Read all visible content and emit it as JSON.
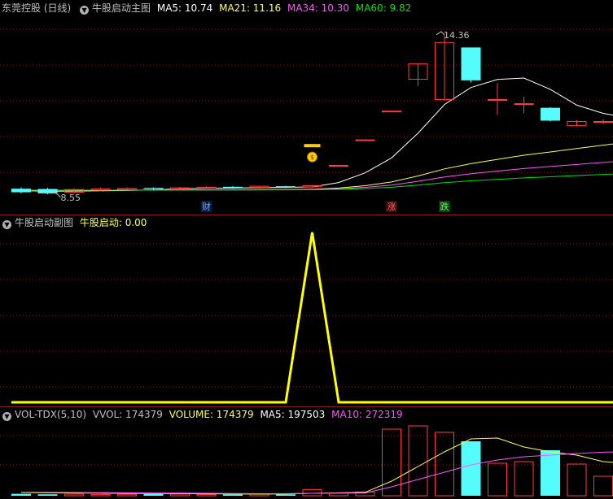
{
  "main": {
    "title": "东莞控股 (日线)",
    "indicator": "牛股启动主图",
    "ma5": "MA5: 10.74",
    "ma21": "MA21: 11.16",
    "ma34": "MA34: 10.30",
    "ma60": "MA60: 9.82",
    "high_label": "14.36",
    "low_label": "8.55",
    "markers": {
      "cai": "财",
      "zhang": "涨",
      "die": "跌"
    },
    "dollar_icon": "money-bag-icon"
  },
  "sub": {
    "title": "牛股启动副图",
    "value_label": "牛股启动: 0.00"
  },
  "vol": {
    "title": "VOL-TDX(5,10)",
    "vvol": "VVOL: 174379",
    "volume": "VOLUME: 174379",
    "ma5": "MA5: 197503",
    "ma10": "MA10: 272319"
  },
  "colors": {
    "up": "#ff3c3c",
    "down": "#54fcfc",
    "ma5": "#ffffff",
    "ma21": "#ffff55",
    "ma34": "#ff55ff",
    "ma60": "#00e000",
    "signal": "#ffff00",
    "grid": "#8b1a1a"
  },
  "chart_data": {
    "type": "candlestick",
    "candles": [
      {
        "o": 8.75,
        "c": 8.62,
        "h": 8.8,
        "l": 8.58
      },
      {
        "o": 8.74,
        "c": 8.58,
        "h": 8.78,
        "l": 8.55
      },
      {
        "o": 8.62,
        "c": 8.72,
        "h": 8.76,
        "l": 8.58
      },
      {
        "o": 8.7,
        "c": 8.74,
        "h": 8.78,
        "l": 8.66
      },
      {
        "o": 8.72,
        "c": 8.76,
        "h": 8.8,
        "l": 8.7
      },
      {
        "o": 8.78,
        "c": 8.74,
        "h": 8.8,
        "l": 8.7
      },
      {
        "o": 8.74,
        "c": 8.78,
        "h": 8.82,
        "l": 8.72
      },
      {
        "o": 8.78,
        "c": 8.8,
        "h": 8.84,
        "l": 8.74
      },
      {
        "o": 8.82,
        "c": 8.78,
        "h": 8.85,
        "l": 8.74
      },
      {
        "o": 8.8,
        "c": 8.84,
        "h": 8.86,
        "l": 8.76
      },
      {
        "o": 8.84,
        "c": 8.8,
        "h": 8.86,
        "l": 8.77
      },
      {
        "o": 8.82,
        "c": 8.86,
        "h": 8.88,
        "l": 8.78
      },
      {
        "o": 9.6,
        "c": 9.6,
        "h": 9.6,
        "l": 9.6
      },
      {
        "o": 10.53,
        "c": 10.53,
        "h": 10.53,
        "l": 10.53
      },
      {
        "o": 11.58,
        "c": 11.58,
        "h": 11.58,
        "l": 11.58
      },
      {
        "o": 12.74,
        "c": 13.3,
        "h": 13.3,
        "l": 12.5
      },
      {
        "o": 12.0,
        "c": 14.08,
        "h": 14.36,
        "l": 12.0
      },
      {
        "o": 13.9,
        "c": 12.7,
        "h": 13.9,
        "l": 12.62
      },
      {
        "o": 12.0,
        "c": 12.0,
        "h": 12.6,
        "l": 11.45
      },
      {
        "o": 11.85,
        "c": 11.85,
        "h": 12.1,
        "l": 11.5
      },
      {
        "o": 11.7,
        "c": 11.23,
        "h": 11.72,
        "l": 11.2
      },
      {
        "o": 11.05,
        "c": 11.2,
        "h": 11.25,
        "l": 11.05
      },
      {
        "o": 11.2,
        "c": 11.2,
        "h": 11.28,
        "l": 11.1
      },
      {
        "o": 11.2,
        "c": 11.12,
        "h": 11.22,
        "l": 11.1
      }
    ],
    "signal": [
      0,
      0,
      0,
      0,
      0,
      0,
      0,
      0,
      0,
      0,
      0,
      1,
      0,
      0,
      0,
      0,
      0,
      0,
      0,
      0,
      0,
      0,
      0,
      0
    ],
    "volume": {
      "values": [
        12000,
        9000,
        10000,
        8000,
        9000,
        11000,
        10000,
        8000,
        9000,
        10000,
        9000,
        38000,
        16000,
        23000,
        410000,
        430000,
        390000,
        335000,
        200000,
        210000,
        280000,
        195000,
        120000,
        125000
      ],
      "vol_ma5": [
        20000,
        18000,
        17000,
        16000,
        15000,
        14000,
        13000,
        12000,
        11000,
        10000,
        11000,
        15000,
        18000,
        21000,
        90000,
        180000,
        270000,
        350000,
        355000,
        300000,
        270000,
        250000,
        210000,
        197503
      ],
      "vol_ma10": [
        22000,
        21000,
        20000,
        19000,
        18000,
        17000,
        16000,
        15000,
        14000,
        13000,
        13000,
        15000,
        16000,
        17000,
        55000,
        100000,
        145000,
        190000,
        220000,
        240000,
        250000,
        260000,
        268000,
        272319
      ]
    }
  }
}
